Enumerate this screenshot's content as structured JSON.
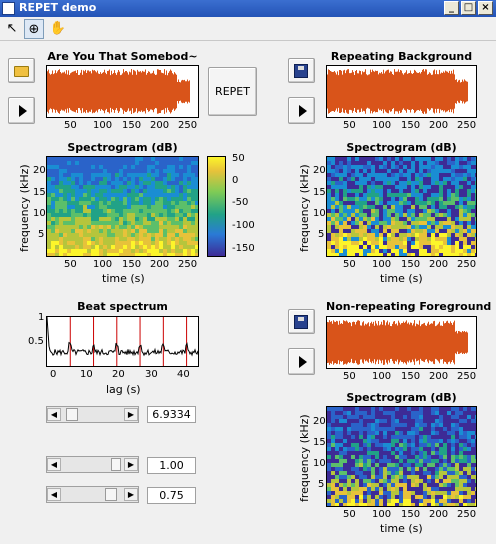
{
  "window": {
    "title": "REPET demo",
    "controls": [
      "_",
      "□",
      "×"
    ]
  },
  "toolbar": {
    "tools": [
      "pointer",
      "zoom",
      "pan"
    ],
    "glyphs": [
      "↖",
      "⊕",
      "✋"
    ]
  },
  "colors": {
    "waveform": "#d9541a",
    "marker": "#cc0000"
  },
  "panels": {
    "mixture": {
      "title": "Are You That Somebod~",
      "xticks": [
        "50",
        "100",
        "150",
        "200",
        "250"
      ]
    },
    "background": {
      "title": "Repeating Background",
      "xticks": [
        "50",
        "100",
        "150",
        "200",
        "250"
      ]
    },
    "foreground": {
      "title": "Non-repeating Foreground",
      "xticks": [
        "50",
        "100",
        "150",
        "200",
        "250"
      ]
    },
    "mix_spec": {
      "title": "Spectrogram (dB)",
      "ylabel": "frequency (kHz)",
      "xlabel": "time (s)",
      "yticks": [
        "20",
        "15",
        "10",
        "5"
      ],
      "xticks": [
        "50",
        "100",
        "150",
        "200",
        "250"
      ]
    },
    "bg_spec": {
      "title": "Spectrogram (dB)",
      "ylabel": "frequency (kHz)",
      "xlabel": "time (s)",
      "yticks": [
        "20",
        "15",
        "10",
        "5"
      ],
      "xticks": [
        "50",
        "100",
        "150",
        "200",
        "250"
      ]
    },
    "fg_spec": {
      "title": "Spectrogram (dB)",
      "ylabel": "frequency (kHz)",
      "xlabel": "time (s)",
      "yticks": [
        "20",
        "15",
        "10",
        "5"
      ],
      "xticks": [
        "50",
        "100",
        "150",
        "200",
        "250"
      ]
    },
    "colorbar": {
      "ticks": [
        "50",
        "0",
        "-50",
        "-100",
        "-150"
      ]
    },
    "beat": {
      "title": "Beat spectrum",
      "xlabel": "lag (s)",
      "yticks": [
        "1",
        "0.5"
      ],
      "xticks": [
        "0",
        "10",
        "20",
        "30",
        "40"
      ]
    }
  },
  "buttons": {
    "repet": "REPET"
  },
  "controls": {
    "period": "6.9334",
    "cutoff": "1.00",
    "threshold": "0.75"
  },
  "chart_data": {
    "type": "line",
    "title": "Beat spectrum",
    "xlabel": "lag (s)",
    "ylabel": "",
    "xlim": [
      0,
      45
    ],
    "ylim": [
      0,
      1
    ],
    "markers": [
      6.9334,
      13.87,
      20.8,
      27.73,
      34.67,
      41.6
    ]
  }
}
